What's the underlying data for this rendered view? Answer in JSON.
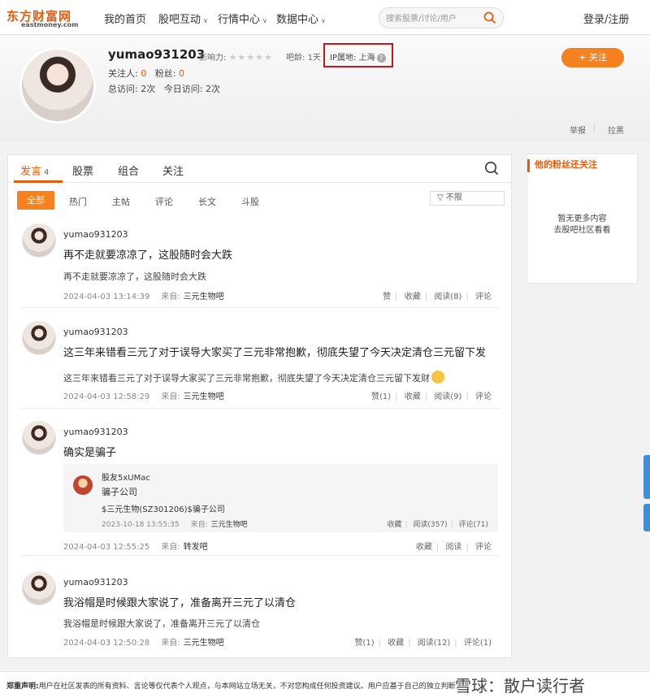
{
  "header": {
    "logo_cn": "东方财富网",
    "logo_en": "eastmoney.com",
    "nav": [
      {
        "label": "我的首页"
      },
      {
        "label": "股吧互动",
        "has_caret": true
      },
      {
        "label": "行情中心",
        "has_caret": true
      },
      {
        "label": "数据中心",
        "has_caret": true
      }
    ],
    "search_placeholder": "搜索股票/讨论/用户",
    "login": "登录/注册",
    "caret": "∨"
  },
  "profile": {
    "username": "yumao931203",
    "influence_label": "影响力:",
    "stars": "★★★★★",
    "bar_age_label": "吧龄:",
    "bar_age_value": "1天",
    "ip_label": "IP属地:",
    "ip_value": "上海",
    "ip_help": "?",
    "following_label": "关注人:",
    "following_value": "0",
    "fans_label": "粉丝:",
    "fans_value": "0",
    "total_visits_label": "总访问:",
    "total_visits_value": "2次",
    "today_visits_label": "今日访问:",
    "today_visits_value": "2次",
    "follow_button": "+ 关注",
    "report": "举报",
    "block": "拉黑"
  },
  "tabs": {
    "items": [
      {
        "label": "发言",
        "count": "4"
      },
      {
        "label": "股票"
      },
      {
        "label": "组合"
      },
      {
        "label": "关注"
      }
    ]
  },
  "filters": {
    "items": [
      "全部",
      "热门",
      "主帖",
      "评论",
      "长文",
      "斗股"
    ],
    "select_label": "不限",
    "select_icon": "▽"
  },
  "posts": [
    {
      "user": "yumao931203",
      "title": "再不走就要凉凉了，这股随时会大跌",
      "body": "再不走就要凉凉了，这股随时会大跌",
      "time": "2024-04-03 13:14:39",
      "from_label": "来自:",
      "source": "三元生物吧",
      "actions": [
        "赞",
        "收藏",
        "阅读(8)",
        "评论"
      ]
    },
    {
      "user": "yumao931203",
      "title": "这三年来错看三元了对于误导大家买了三元非常抱歉，彻底失望了今天决定清仓三元留下发",
      "body": "这三年来错看三元了对于误导大家买了三元非常抱歉，彻底失望了今天决定清仓三元留下发财",
      "time": "2024-04-03 12:58:29",
      "from_label": "来自:",
      "source": "三元生物吧",
      "actions": [
        "赞(1)",
        "收藏",
        "阅读(9)",
        "评论"
      ]
    },
    {
      "user": "yumao931203",
      "title": "确实是骗子",
      "time": "2024-04-03 12:55:25",
      "from_label": "来自:",
      "source": "转发吧",
      "actions": [
        "收藏",
        "阅读",
        "评论"
      ],
      "quote": {
        "user": "股友5xUMac",
        "title": "骗子公司",
        "body": "$三元生物(SZ301206)$骗子公司",
        "time": "2023-10-18 13:55:35",
        "from_label": "来自:",
        "source": "三元生物吧",
        "actions": [
          "收藏",
          "阅读(357)",
          "评论(71)"
        ]
      }
    },
    {
      "user": "yumao931203",
      "title": "我浴帽是时候跟大家说了，准备离开三元了以清仓",
      "body": "我浴帽是时候跟大家说了，准备离开三元了以清仓",
      "time": "2024-04-03 12:50:28",
      "from_label": "来自:",
      "source": "三元生物吧",
      "actions": [
        "赞(1)",
        "收藏",
        "阅读(12)",
        "评论(1)"
      ]
    }
  ],
  "sidebar": {
    "title": "他的粉丝还关注",
    "empty_line1": "暂无更多内容",
    "empty_line2": "去股吧社区看看"
  },
  "footer": {
    "disclaimer_label": "郑重声明:",
    "disclaimer": "用户在社区发表的所有资料、言论等仅代表个人观点，与本网站立场无关，不对您构成任何投资建议。用户应基于自己的独立判断，自行决定证券投资并承担相应风险。",
    "watermark": "雪球：散户读行者"
  },
  "colors": {
    "brand_orange": "#e85d0b",
    "button_orange": "#f5811f",
    "ip_highlight": "#c8161d"
  },
  "icons": {
    "search": "search-icon",
    "help": "help-icon",
    "filter": "filter-icon"
  }
}
